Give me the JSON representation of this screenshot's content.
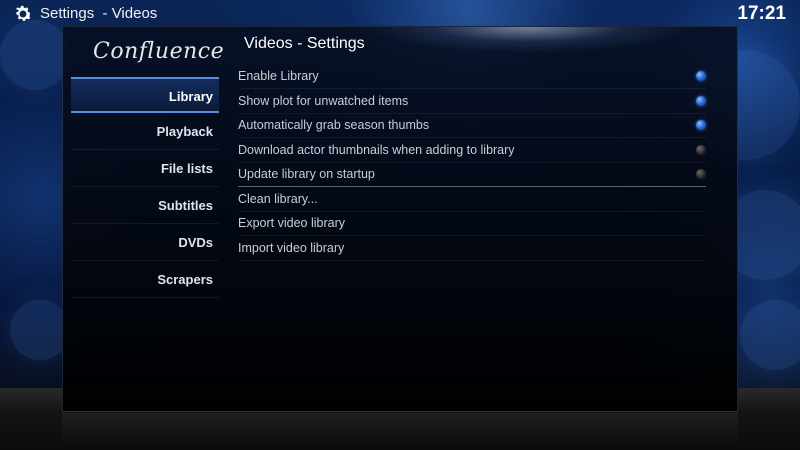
{
  "topbar": {
    "breadcrumb": "Settings  - Videos",
    "clock": "17:21"
  },
  "skin_logo": "Confluence",
  "panel": {
    "title": "Videos - Settings"
  },
  "categories": [
    {
      "label": "Library",
      "active": true
    },
    {
      "label": "Playback"
    },
    {
      "label": "File lists"
    },
    {
      "label": "Subtitles"
    },
    {
      "label": "DVDs"
    },
    {
      "label": "Scrapers"
    }
  ],
  "settings": [
    {
      "label": "Enable Library",
      "type": "toggle",
      "value": true
    },
    {
      "label": "Show plot for unwatched items",
      "type": "toggle",
      "value": true
    },
    {
      "label": "Automatically grab season thumbs",
      "type": "toggle",
      "value": true
    },
    {
      "label": "Download actor thumbnails when adding to library",
      "type": "toggle",
      "value": false
    },
    {
      "label": "Update library on startup",
      "type": "toggle",
      "value": false
    },
    {
      "label": "Clean library...",
      "type": "action"
    },
    {
      "label": "Export video library",
      "type": "action"
    },
    {
      "label": "Import video library",
      "type": "action"
    }
  ],
  "colors": {
    "toggle_on": "#2a6de0",
    "toggle_off": "#2c2c2c",
    "accent": "#6eaaff"
  },
  "icons": {
    "topbar": "gear-icon"
  }
}
